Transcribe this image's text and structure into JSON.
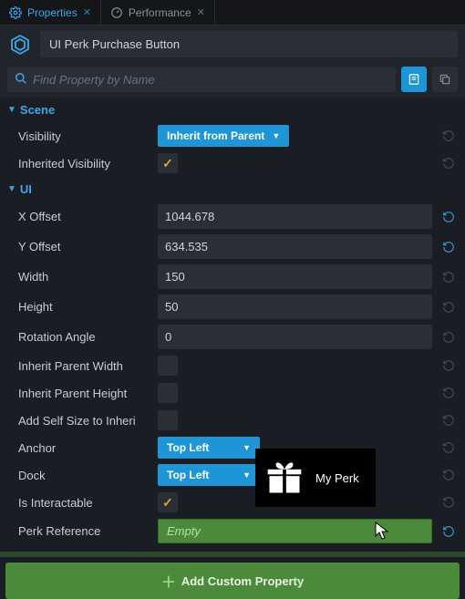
{
  "tabs": {
    "properties": "Properties",
    "performance": "Performance"
  },
  "object_name": "UI Perk Purchase Button",
  "search_placeholder": "Find Property by Name",
  "sections": {
    "scene": {
      "title": "Scene",
      "visibility_label": "Visibility",
      "visibility_value": "Inherit from Parent",
      "inherited_visibility_label": "Inherited Visibility",
      "inherited_visibility_checked": true
    },
    "ui": {
      "title": "UI",
      "x_offset_label": "X Offset",
      "x_offset_value": "1044.678",
      "y_offset_label": "Y Offset",
      "y_offset_value": "634.535",
      "width_label": "Width",
      "width_value": "150",
      "height_label": "Height",
      "height_value": "50",
      "rotation_label": "Rotation Angle",
      "rotation_value": "0",
      "inherit_parent_width_label": "Inherit Parent Width",
      "inherit_parent_width_checked": false,
      "inherit_parent_height_label": "Inherit Parent Height",
      "inherit_parent_height_checked": false,
      "add_self_size_label": "Add Self Size to Inheri",
      "add_self_size_checked": false,
      "anchor_label": "Anchor",
      "anchor_value": "Top Left",
      "dock_label": "Dock",
      "dock_value": "Top Left",
      "is_interactable_label": "Is Interactable",
      "is_interactable_checked": true,
      "perk_reference_label": "Perk Reference",
      "perk_reference_value": "Empty"
    }
  },
  "tooltip": {
    "label": "My Perk"
  },
  "footer_button": "Add Custom Property"
}
